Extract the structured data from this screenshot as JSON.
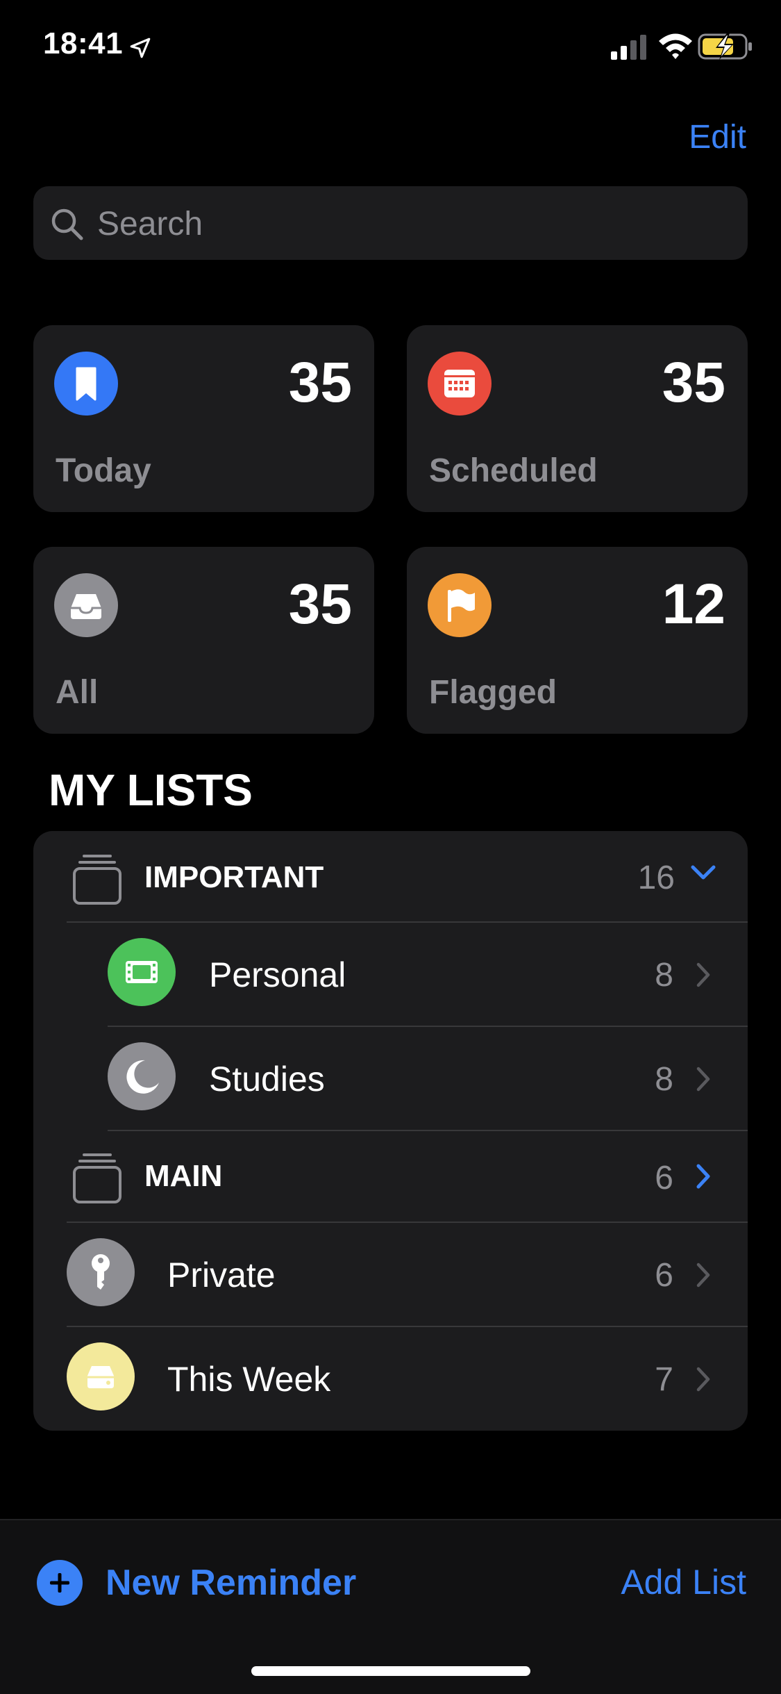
{
  "status_bar": {
    "time": "18:41"
  },
  "header": {
    "edit_label": "Edit"
  },
  "search": {
    "placeholder": "Search"
  },
  "smart_lists": [
    {
      "label": "Today",
      "count": "35",
      "icon": "bookmark-icon",
      "color": "#3478f6"
    },
    {
      "label": "Scheduled",
      "count": "35",
      "icon": "calendar-icon",
      "color": "#ea4b3d"
    },
    {
      "label": "All",
      "count": "35",
      "icon": "tray-icon",
      "color": "#8e8e93"
    },
    {
      "label": "Flagged",
      "count": "12",
      "icon": "flag-icon",
      "color": "#f19a37"
    }
  ],
  "my_lists": {
    "title": "MY LISTS",
    "groups": [
      {
        "name": "IMPORTANT",
        "count": "16",
        "expanded": true,
        "lists": [
          {
            "name": "Personal",
            "count": "8",
            "icon": "film-icon",
            "color": "#4cc25a"
          },
          {
            "name": "Studies",
            "count": "8",
            "icon": "moon-icon",
            "color": "#8e8e93"
          }
        ]
      },
      {
        "name": "MAIN",
        "count": "6",
        "expanded": false,
        "lists": []
      }
    ],
    "lists": [
      {
        "name": "Private",
        "count": "6",
        "icon": "key-icon",
        "color": "#8e8e93"
      },
      {
        "name": "This Week",
        "count": "7",
        "icon": "drive-icon",
        "color": "#f3e99b"
      }
    ]
  },
  "toolbar": {
    "new_reminder_label": "New Reminder",
    "add_list_label": "Add List"
  },
  "colors": {
    "accent": "#3b82f6",
    "background": "#000000",
    "card": "#1c1c1e"
  }
}
